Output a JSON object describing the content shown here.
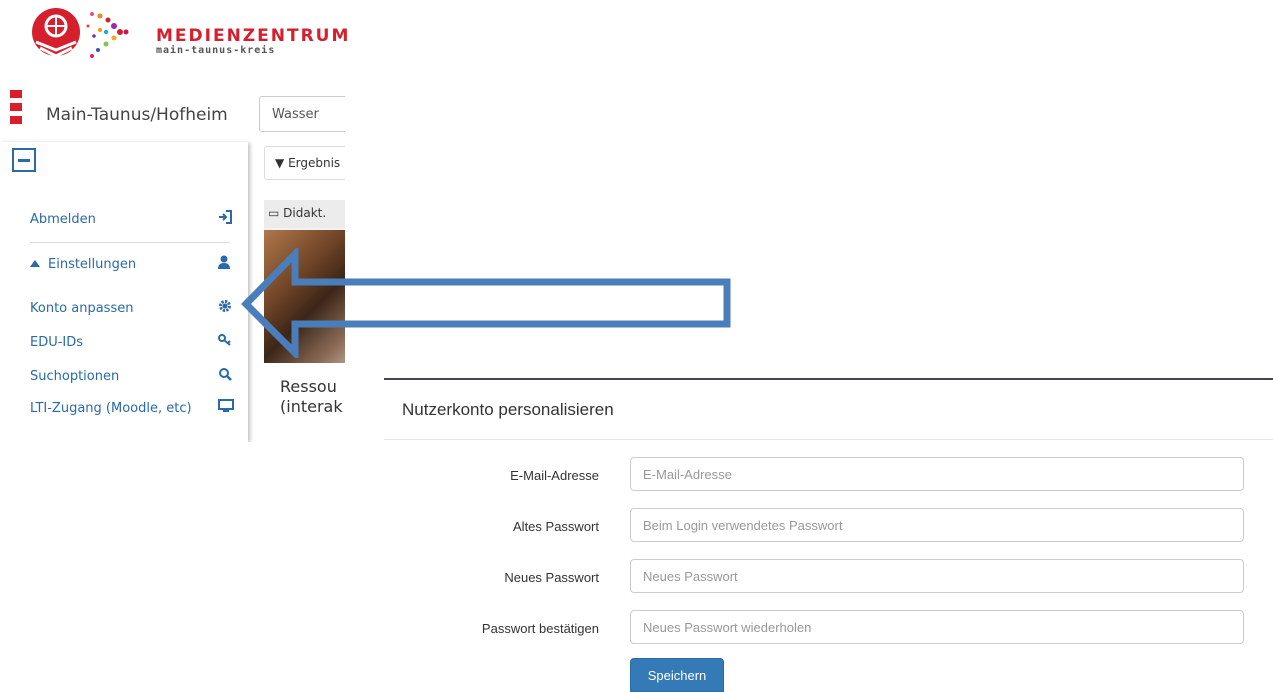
{
  "logo": {
    "title": "MEDIENZENTRUM",
    "subtitle": "main-taunus-kreis"
  },
  "header": {
    "instance": "Main-Taunus/Hofheim",
    "search_value": "Wasser"
  },
  "menu": {
    "items": [
      {
        "label": "Abmelden",
        "icon": "sign-in-icon"
      },
      {
        "label": "Einstellungen",
        "icon": "user-icon"
      },
      {
        "label": "Konto anpassen",
        "icon": "gear-icon"
      },
      {
        "label": "EDU-IDs",
        "icon": "key-icon"
      },
      {
        "label": "Suchoptionen",
        "icon": "search-icon"
      },
      {
        "label": "LTI-Zugang (Moodle, etc)",
        "icon": "monitor-icon"
      }
    ]
  },
  "results": {
    "filter_label": "Ergebnis",
    "card_type": "Didakt.",
    "card_title_line1": "Ressou",
    "card_title_line2": "(interak"
  },
  "form": {
    "title": "Nutzerkonto personalisieren",
    "fields": [
      {
        "label": "E-Mail-Adresse",
        "placeholder": "E-Mail-Adresse"
      },
      {
        "label": "Altes Passwort",
        "placeholder": "Beim Login verwendetes Passwort"
      },
      {
        "label": "Neues Passwort",
        "placeholder": "Neues Passwort"
      },
      {
        "label": "Passwort bestätigen",
        "placeholder": "Neues Passwort wiederholen"
      }
    ],
    "save_label": "Speichern"
  },
  "colors": {
    "brand_red": "#d61f2c",
    "link_blue": "#2a6aa8",
    "arrow_blue": "#4a7ebb",
    "button_blue": "#337ab7"
  }
}
